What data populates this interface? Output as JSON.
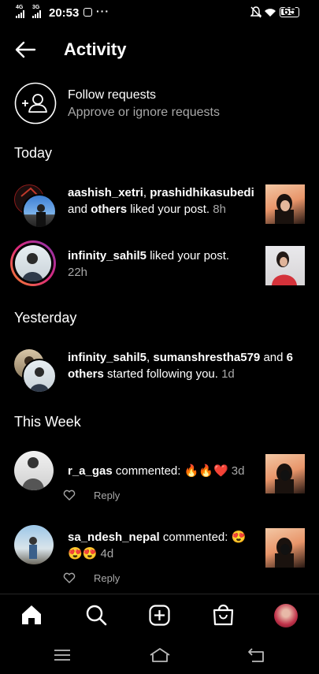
{
  "status_bar": {
    "net1": "4G",
    "net2": "3G",
    "time": "20:53",
    "battery": "65"
  },
  "header": {
    "title": "Activity"
  },
  "follow_requests": {
    "title": "Follow requests",
    "subtitle": "Approve or ignore requests"
  },
  "sections": {
    "today": "Today",
    "yesterday": "Yesterday",
    "this_week": "This Week"
  },
  "items": [
    {
      "user1": "aashish_xetri",
      "sep": ", ",
      "user2": "prashidhikasubedi",
      "and": "and ",
      "others": "others",
      "action": " liked your post.",
      "time": "8h"
    },
    {
      "user": "infinity_sahil5",
      "action": " liked your post.",
      "time": "22h"
    },
    {
      "user1": "infinity_sahil5",
      "sep": ", ",
      "user2": "sumanshrestha579",
      "and": " and ",
      "others": "6 others",
      "action": " started following you.",
      "time": "1d"
    },
    {
      "user": "r_a_gas",
      "action": " commented: 🔥🔥❤️",
      "time": "3d",
      "reply": "Reply"
    },
    {
      "user": "sa_ndesh_nepal",
      "action": " commented: 😍",
      "action2": "😍😍",
      "time": "4d",
      "reply": "Reply"
    }
  ],
  "colors": {
    "background": "#000000",
    "muted": "#a8a8a8",
    "story_ring_start": "#f58529",
    "story_ring_end": "#dd2a7b",
    "heart_red": "#e0245e"
  },
  "icons": [
    "back-arrow-icon",
    "add-person-icon",
    "home-icon",
    "search-icon",
    "create-icon",
    "shop-icon",
    "heart-icon",
    "menu-icon",
    "home-key-icon",
    "back-key-icon"
  ]
}
